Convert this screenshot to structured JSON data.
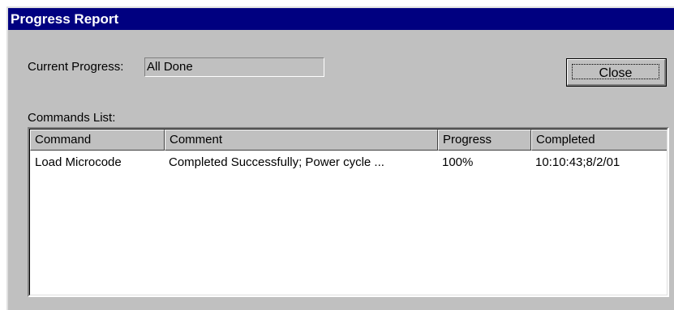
{
  "window": {
    "title": "Progress Report"
  },
  "progress": {
    "label": "Current Progress:",
    "value": "All Done"
  },
  "buttons": {
    "close_label": "Close"
  },
  "commands": {
    "label": "Commands List:",
    "columns": [
      "Command",
      "Comment",
      "Progress",
      "Completed"
    ],
    "rows": [
      {
        "command": "Load Microcode",
        "comment": "Completed Successfully; Power cycle ...",
        "progress": "100%",
        "completed": "10:10:43;8/2/01"
      }
    ]
  },
  "colors": {
    "titlebar": "#000080",
    "face": "#c0c0c0",
    "list_background": "#ffffff"
  }
}
